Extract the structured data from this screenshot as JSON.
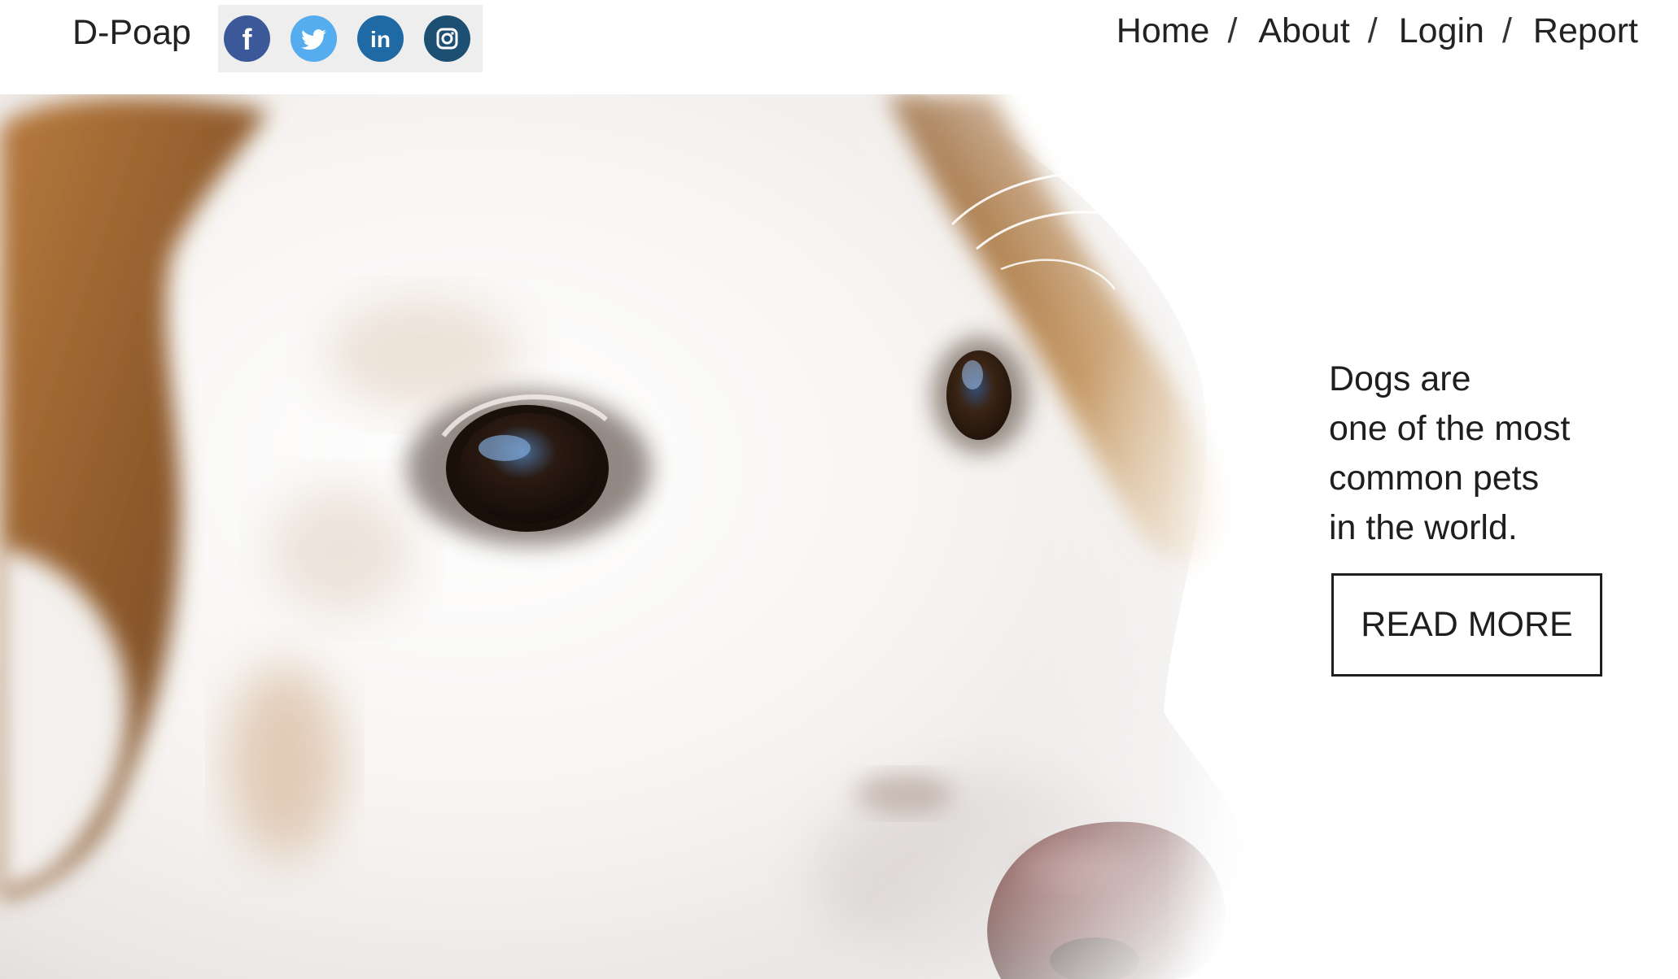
{
  "header": {
    "brand": "D-Poap",
    "social": [
      {
        "icon": "facebook-icon",
        "label": "f",
        "color": "#3b5998"
      },
      {
        "icon": "twitter-icon",
        "color": "#55acee"
      },
      {
        "icon": "linkedin-icon",
        "label": "in",
        "color": "#1f6aa5"
      },
      {
        "icon": "instagram-icon",
        "color": "#1d4f73"
      }
    ],
    "social_bar_color": "#eeeeee"
  },
  "nav": {
    "home": "Home",
    "about": "About",
    "login": "Login",
    "report": "Report",
    "separator": "/"
  },
  "hero": {
    "image": "dog-portrait-image",
    "tagline_lines": [
      "Dogs are",
      "one of the most",
      "common pets",
      "in the world."
    ],
    "cta_label": "READ MORE"
  },
  "colors": {
    "background": "#ffffff",
    "text": "#1e1e1e",
    "fur_brown": "#9a6330",
    "nose": "#6b3a36"
  }
}
